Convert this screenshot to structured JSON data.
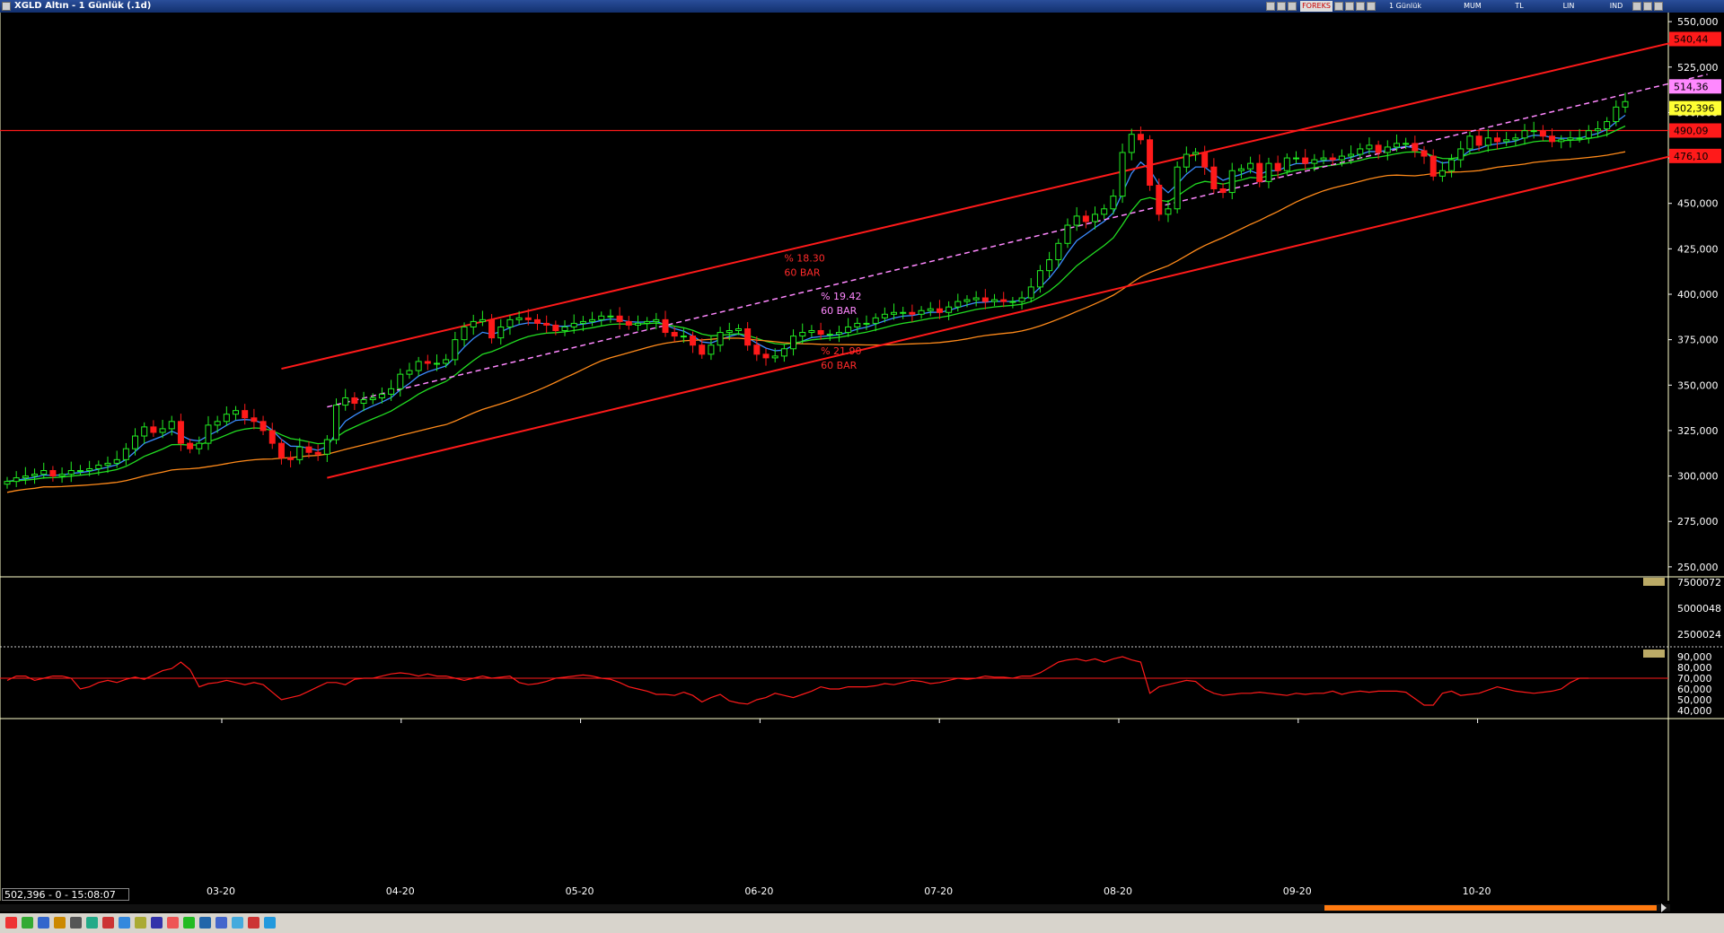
{
  "window": {
    "title": "XGLD  Altın - 1 Günlük (.1d)"
  },
  "toolbar": {
    "brand": "FOREKS",
    "period": "1 Günlük",
    "style": "MUM",
    "currency": "TL",
    "scale": "LIN",
    "mode": "IND"
  },
  "status": {
    "readout": "502,396 - 0 - 15:08:07"
  },
  "chart_data": {
    "type": "candlestick",
    "symbol": "XGLD",
    "price_axis": {
      "ticks": [
        "550,000",
        "525,000",
        "500,000",
        "475,000",
        "450,000",
        "425,000",
        "400,000",
        "375,000",
        "350,000",
        "325,000",
        "300,000",
        "275,000",
        "250,000"
      ],
      "ylim": [
        245,
        555
      ]
    },
    "x_ticks": [
      "03-20",
      "04-20",
      "05-20",
      "06-20",
      "07-20",
      "08-20",
      "09-20",
      "10-20"
    ],
    "price_labels": [
      {
        "text": "540,44",
        "value": 540.44,
        "color": "#ff1a1a"
      },
      {
        "text": "514,36",
        "value": 514.36,
        "color": "#ff88ff"
      },
      {
        "text": "502,396",
        "value": 502.4,
        "color": "#ffff33"
      },
      {
        "text": "490,09",
        "value": 490.09,
        "color": "#ff1a1a"
      },
      {
        "text": "476,10",
        "value": 476.1,
        "color": "#ff1a1a"
      }
    ],
    "annotations": [
      {
        "pct": "% 18.30",
        "bars": "60 BAR",
        "color": "#ff2a2a",
        "at_bar": 85,
        "at_price": 418
      },
      {
        "pct": "% 19.42",
        "bars": "60 BAR",
        "color": "#ff88ff",
        "at_bar": 89,
        "at_price": 397
      },
      {
        "pct": "% 21.90",
        "bars": "60 BAR",
        "color": "#ff2a2a",
        "at_bar": 89,
        "at_price": 367
      }
    ],
    "horizontal_line": {
      "value": 490.09,
      "color": "#ff1a1a"
    },
    "trend_lines": [
      {
        "from": [
          30,
          359
        ],
        "to": [
          186,
          543
        ],
        "color": "#ff1a1a",
        "style": "solid"
      },
      {
        "from": [
          35,
          299
        ],
        "to": [
          182,
          476
        ],
        "color": "#ff1a1a",
        "style": "solid"
      },
      {
        "from": [
          35,
          338
        ],
        "to": [
          186,
          521
        ],
        "color": "#ff88ff",
        "style": "dashed"
      }
    ],
    "closes": [
      297,
      299,
      300,
      301,
      303,
      300,
      301,
      303,
      303,
      304,
      306,
      307,
      309,
      315,
      322,
      327,
      324,
      326,
      330,
      318,
      315,
      318,
      328,
      330,
      334,
      336,
      332,
      330,
      325,
      318,
      310,
      309,
      316,
      313,
      312,
      320,
      339,
      343,
      340,
      342,
      343,
      345,
      348,
      356,
      358,
      363,
      362,
      362,
      364,
      375,
      382,
      385,
      386,
      376,
      382,
      386,
      387,
      386,
      384,
      383,
      380,
      382,
      384,
      385,
      386,
      388,
      388,
      385,
      383,
      384,
      385,
      386,
      379,
      377,
      377,
      372,
      367,
      372,
      379,
      380,
      381,
      372,
      367,
      365,
      366,
      370,
      377,
      379,
      380,
      378,
      378,
      379,
      382,
      384,
      384,
      387,
      389,
      390,
      390,
      389,
      391,
      392,
      390,
      393,
      396,
      397,
      398,
      396,
      397,
      396,
      396,
      398,
      404,
      413,
      419,
      428,
      438,
      443,
      440,
      444,
      447,
      454,
      478,
      488,
      485,
      460,
      444,
      447,
      470,
      477,
      478,
      470,
      458,
      456,
      468,
      469,
      472,
      462,
      472,
      468,
      475,
      475,
      472,
      474,
      475,
      474,
      476,
      477,
      480,
      482,
      478,
      481,
      483,
      483,
      479,
      476,
      465,
      468,
      474,
      480,
      487,
      482,
      486,
      484,
      485,
      486,
      490,
      490,
      487,
      484,
      485,
      486,
      486,
      490,
      491,
      495,
      503,
      506
    ],
    "vol_axis": {
      "ticks": [
        "7500072",
        "5000048",
        "2500024"
      ]
    },
    "osc_axis": {
      "ticks": [
        "90,000",
        "80,000",
        "70,000",
        "60,000",
        "50,000",
        "40,000"
      ],
      "ylim": [
        35,
        95
      ],
      "level": 70
    },
    "osc_values": [
      68,
      72,
      72,
      68,
      70,
      72,
      72,
      70,
      60,
      62,
      66,
      68,
      66,
      69,
      71,
      69,
      73,
      77,
      79,
      85,
      78,
      62,
      65,
      66,
      68,
      66,
      64,
      66,
      64,
      57,
      50,
      52,
      54,
      58,
      62,
      66,
      66,
      64,
      69,
      70,
      70,
      72,
      74,
      75,
      74,
      72,
      74,
      72,
      72,
      70,
      68,
      70,
      72,
      70,
      71,
      72,
      66,
      64,
      65,
      67,
      70,
      71,
      72,
      73,
      72,
      70,
      69,
      66,
      62,
      60,
      58,
      55,
      55,
      54,
      57,
      54,
      48,
      52,
      55,
      49,
      47,
      46,
      50,
      52,
      56,
      54,
      52,
      55,
      58,
      62,
      60,
      60,
      62,
      62,
      62,
      63,
      65,
      64,
      66,
      68,
      67,
      65,
      66,
      68,
      70,
      69,
      70,
      72,
      71,
      71,
      70,
      72,
      72,
      75,
      80,
      85,
      87,
      88,
      86,
      88,
      85,
      88,
      90,
      87,
      85,
      56,
      62,
      64,
      66,
      68,
      67,
      60,
      56,
      54,
      55,
      56,
      56,
      57,
      56,
      55,
      54,
      56,
      55,
      56,
      56,
      58,
      55,
      57,
      58,
      57,
      58,
      58,
      58,
      57,
      51,
      45,
      45,
      56,
      58,
      54,
      55,
      56,
      59,
      62,
      60,
      58,
      57,
      56,
      57,
      58,
      60,
      66,
      70,
      70
    ]
  }
}
